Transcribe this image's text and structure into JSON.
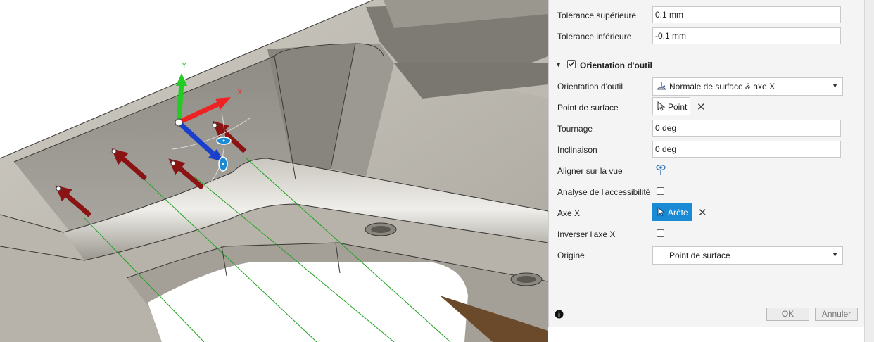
{
  "viewport": {
    "gizmo": {
      "y_label": "Y",
      "x_label": "X"
    },
    "colors": {
      "axis_y": "#22cc22",
      "axis_x": "#ee2222",
      "axis_z": "#1a3fcc",
      "arrows": "#8a1414",
      "toolpath": "#1fa31f"
    }
  },
  "panel": {
    "tolerance_upper": {
      "label": "Tolérance supérieure",
      "value": "0.1 mm"
    },
    "tolerance_lower": {
      "label": "Tolérance inférieure",
      "value": "-0.1 mm"
    },
    "section": {
      "title": "Orientation d'outil",
      "checked": true,
      "toggle_icon": "triangle-down-icon"
    },
    "tool_orientation": {
      "label": "Orientation d'outil",
      "value": "Normale de surface & axe X"
    },
    "surface_point": {
      "label": "Point de surface",
      "button": "Point"
    },
    "turning": {
      "label": "Tournage",
      "value": "0 deg"
    },
    "tilt": {
      "label": "Inclinaison",
      "value": "0 deg"
    },
    "align_view": {
      "label": "Aligner sur la vue",
      "icon": "eye-pin-icon"
    },
    "accessibility": {
      "label": "Analyse de l'accessibilité",
      "checked": false
    },
    "x_axis": {
      "label": "Axe X",
      "button": "Arête"
    },
    "invert_x": {
      "label": "Inverser l'axe X",
      "checked": false
    },
    "origin": {
      "label": "Origine",
      "value": "Point de surface"
    },
    "footer": {
      "info_icon": "info-icon",
      "ok": "OK",
      "cancel": "Annuler"
    }
  }
}
